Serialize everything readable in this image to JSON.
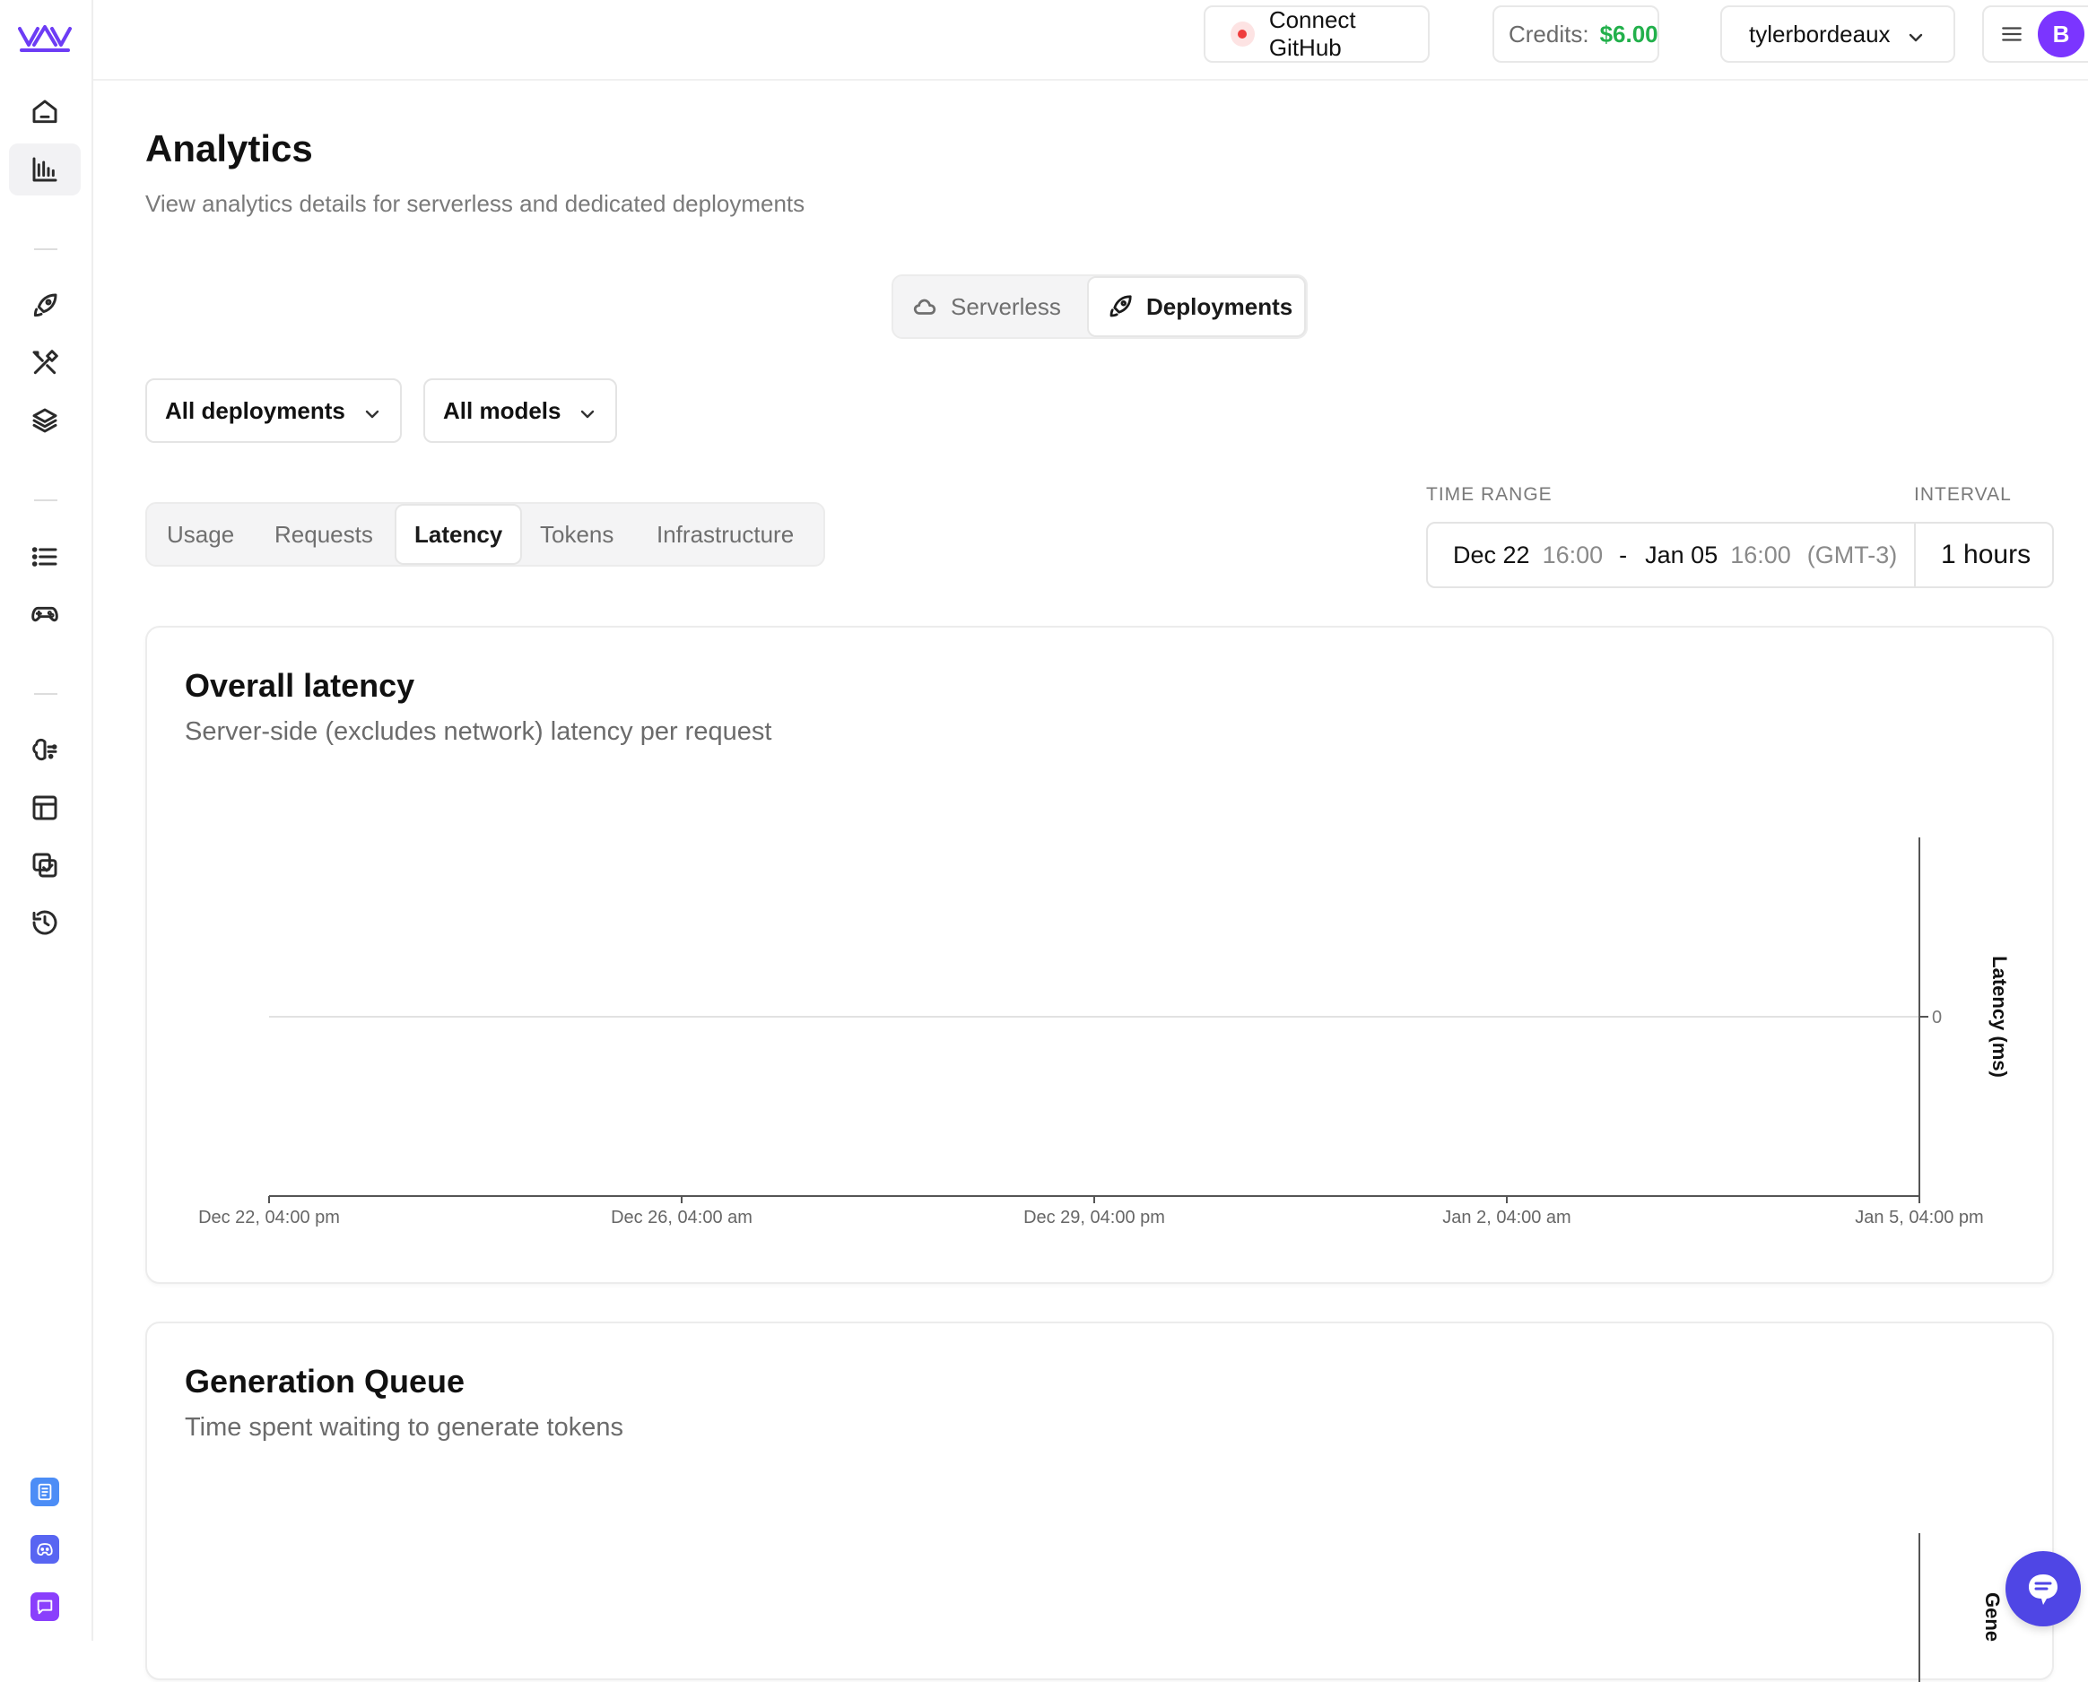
{
  "topbar": {
    "connect_github": "Connect GitHub",
    "credits_label": "Credits:",
    "credits_value": "$6.00",
    "username": "tylerbordeaux",
    "avatar_initial": "B"
  },
  "page": {
    "title": "Analytics",
    "subtitle": "View analytics details for serverless and dedicated deployments"
  },
  "mode_switch": {
    "serverless": "Serverless",
    "deployments": "Deployments",
    "selected": "Deployments"
  },
  "filters": {
    "deployments": "All deployments",
    "models": "All models"
  },
  "tabs": {
    "items": [
      "Usage",
      "Requests",
      "Latency",
      "Tokens",
      "Infrastructure"
    ],
    "active": "Latency"
  },
  "time_range": {
    "label": "TIME RANGE",
    "start_date": "Dec 22",
    "start_time": "16:00",
    "separator": "-",
    "end_date": "Jan 05",
    "end_time": "16:00",
    "timezone": "(GMT-3)",
    "interval_label": "INTERVAL",
    "interval_value": "1 hours"
  },
  "charts": [
    {
      "title": "Overall latency",
      "subtitle": "Server-side (excludes network) latency per request"
    },
    {
      "title": "Generation Queue",
      "subtitle": "Time spent waiting to generate tokens"
    }
  ],
  "chart_data": [
    {
      "type": "line",
      "title": "Overall latency",
      "subtitle": "Server-side (excludes network) latency per request",
      "xlabel": "",
      "ylabel": "Latency (ms)",
      "x_ticks": [
        "Dec 22, 04:00 pm",
        "Dec 26, 04:00 am",
        "Dec 29, 04:00 pm",
        "Jan 2, 04:00 am",
        "Jan 5, 04:00 pm"
      ],
      "y_ticks": [
        "0"
      ],
      "series": [],
      "grid": true,
      "y_axis_side": "right"
    },
    {
      "type": "line",
      "title": "Generation Queue",
      "subtitle": "Time spent waiting to generate tokens",
      "ylabel": "Gene",
      "series": [],
      "y_axis_side": "right"
    }
  ],
  "colors": {
    "brand": "#7b35ff",
    "credits": "#22b04b",
    "alert_dot": "#ef3b3b",
    "chat": "#4f46e5"
  },
  "icons": {
    "sidebar": [
      "home-icon",
      "analytics-icon",
      "rocket-icon",
      "tools-icon",
      "layers-icon",
      "list-icon",
      "gamepad-icon",
      "brain-icon",
      "table-icon",
      "checklist-icon",
      "history-icon"
    ],
    "sidebar_bottom": [
      "docs-icon",
      "discord-icon",
      "feedback-icon"
    ]
  }
}
